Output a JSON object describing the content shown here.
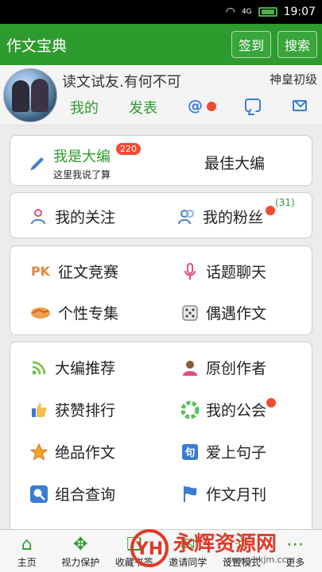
{
  "status_bar": {
    "time": "19:07",
    "network": "4G",
    "wifi_icon": "wifi-icon",
    "battery_icon": "battery-icon"
  },
  "header": {
    "title": "作文宝典",
    "signin_label": "签到",
    "search_label": "搜索"
  },
  "profile": {
    "username": "读文试友.有何不可",
    "rank": "神皇初级",
    "mine_label": "我的",
    "publish_label": "发表",
    "at_symbol": "@"
  },
  "editor_card": {
    "title": "我是大编",
    "badge": "220",
    "subtitle": "这里我说了算",
    "best_label": "最佳大编"
  },
  "follow_card": {
    "following_label": "我的关注",
    "fans_label": "我的粉丝",
    "fans_count": "(31)"
  },
  "activity_card": {
    "contest_label": "征文竞赛",
    "contest_icon_text": "PK",
    "topic_label": "话题聊天",
    "collection_label": "个性专集",
    "random_label": "偶遇作文"
  },
  "features_card": {
    "recommend_label": "大编推荐",
    "author_label": "原创作者",
    "ranking_label": "获赞排行",
    "guild_label": "我的公会",
    "premium_label": "绝品作文",
    "sentence_label": "爱上句子",
    "query_label": "组合查询",
    "monthly_label": "作文月刊"
  },
  "bottom_nav": {
    "home": "主页",
    "eye": "视力保护",
    "bookmark": "收藏书签",
    "invite": "邀请同学",
    "test": "设置模式",
    "more": "更多"
  },
  "watermark": {
    "text": "永辉资源网",
    "url": "www.yhkjm.cc"
  },
  "colors": {
    "brand_green": "#2e9b2e",
    "accent_blue": "#3a7bd5",
    "badge_red": "#f04b32"
  }
}
